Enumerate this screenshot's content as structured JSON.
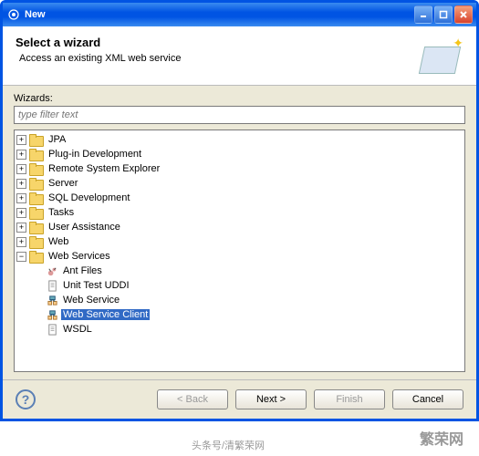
{
  "window": {
    "title": "New"
  },
  "banner": {
    "title": "Select a wizard",
    "subtitle": "Access an existing XML web service"
  },
  "wizards_label": "Wizards:",
  "filter_placeholder": "type filter text",
  "tree": {
    "folders": [
      {
        "label": "JPA"
      },
      {
        "label": "Plug-in Development"
      },
      {
        "label": "Remote System Explorer"
      },
      {
        "label": "Server"
      },
      {
        "label": "SQL Development"
      },
      {
        "label": "Tasks"
      },
      {
        "label": "User Assistance"
      },
      {
        "label": "Web"
      }
    ],
    "open_folder": {
      "label": "Web Services"
    },
    "leaves": [
      {
        "label": "Ant Files",
        "icon": "ant"
      },
      {
        "label": "Unit Test UDDI",
        "icon": "doc"
      },
      {
        "label": "Web Service",
        "icon": "ws"
      },
      {
        "label": "Web Service Client",
        "icon": "ws",
        "selected": true
      },
      {
        "label": "WSDL",
        "icon": "doc"
      }
    ]
  },
  "buttons": {
    "back": "< Back",
    "next": "Next >",
    "finish": "Finish",
    "cancel": "Cancel"
  },
  "watermark": {
    "attribution": "头条号/清繁荣网",
    "site": "繁荣网"
  }
}
